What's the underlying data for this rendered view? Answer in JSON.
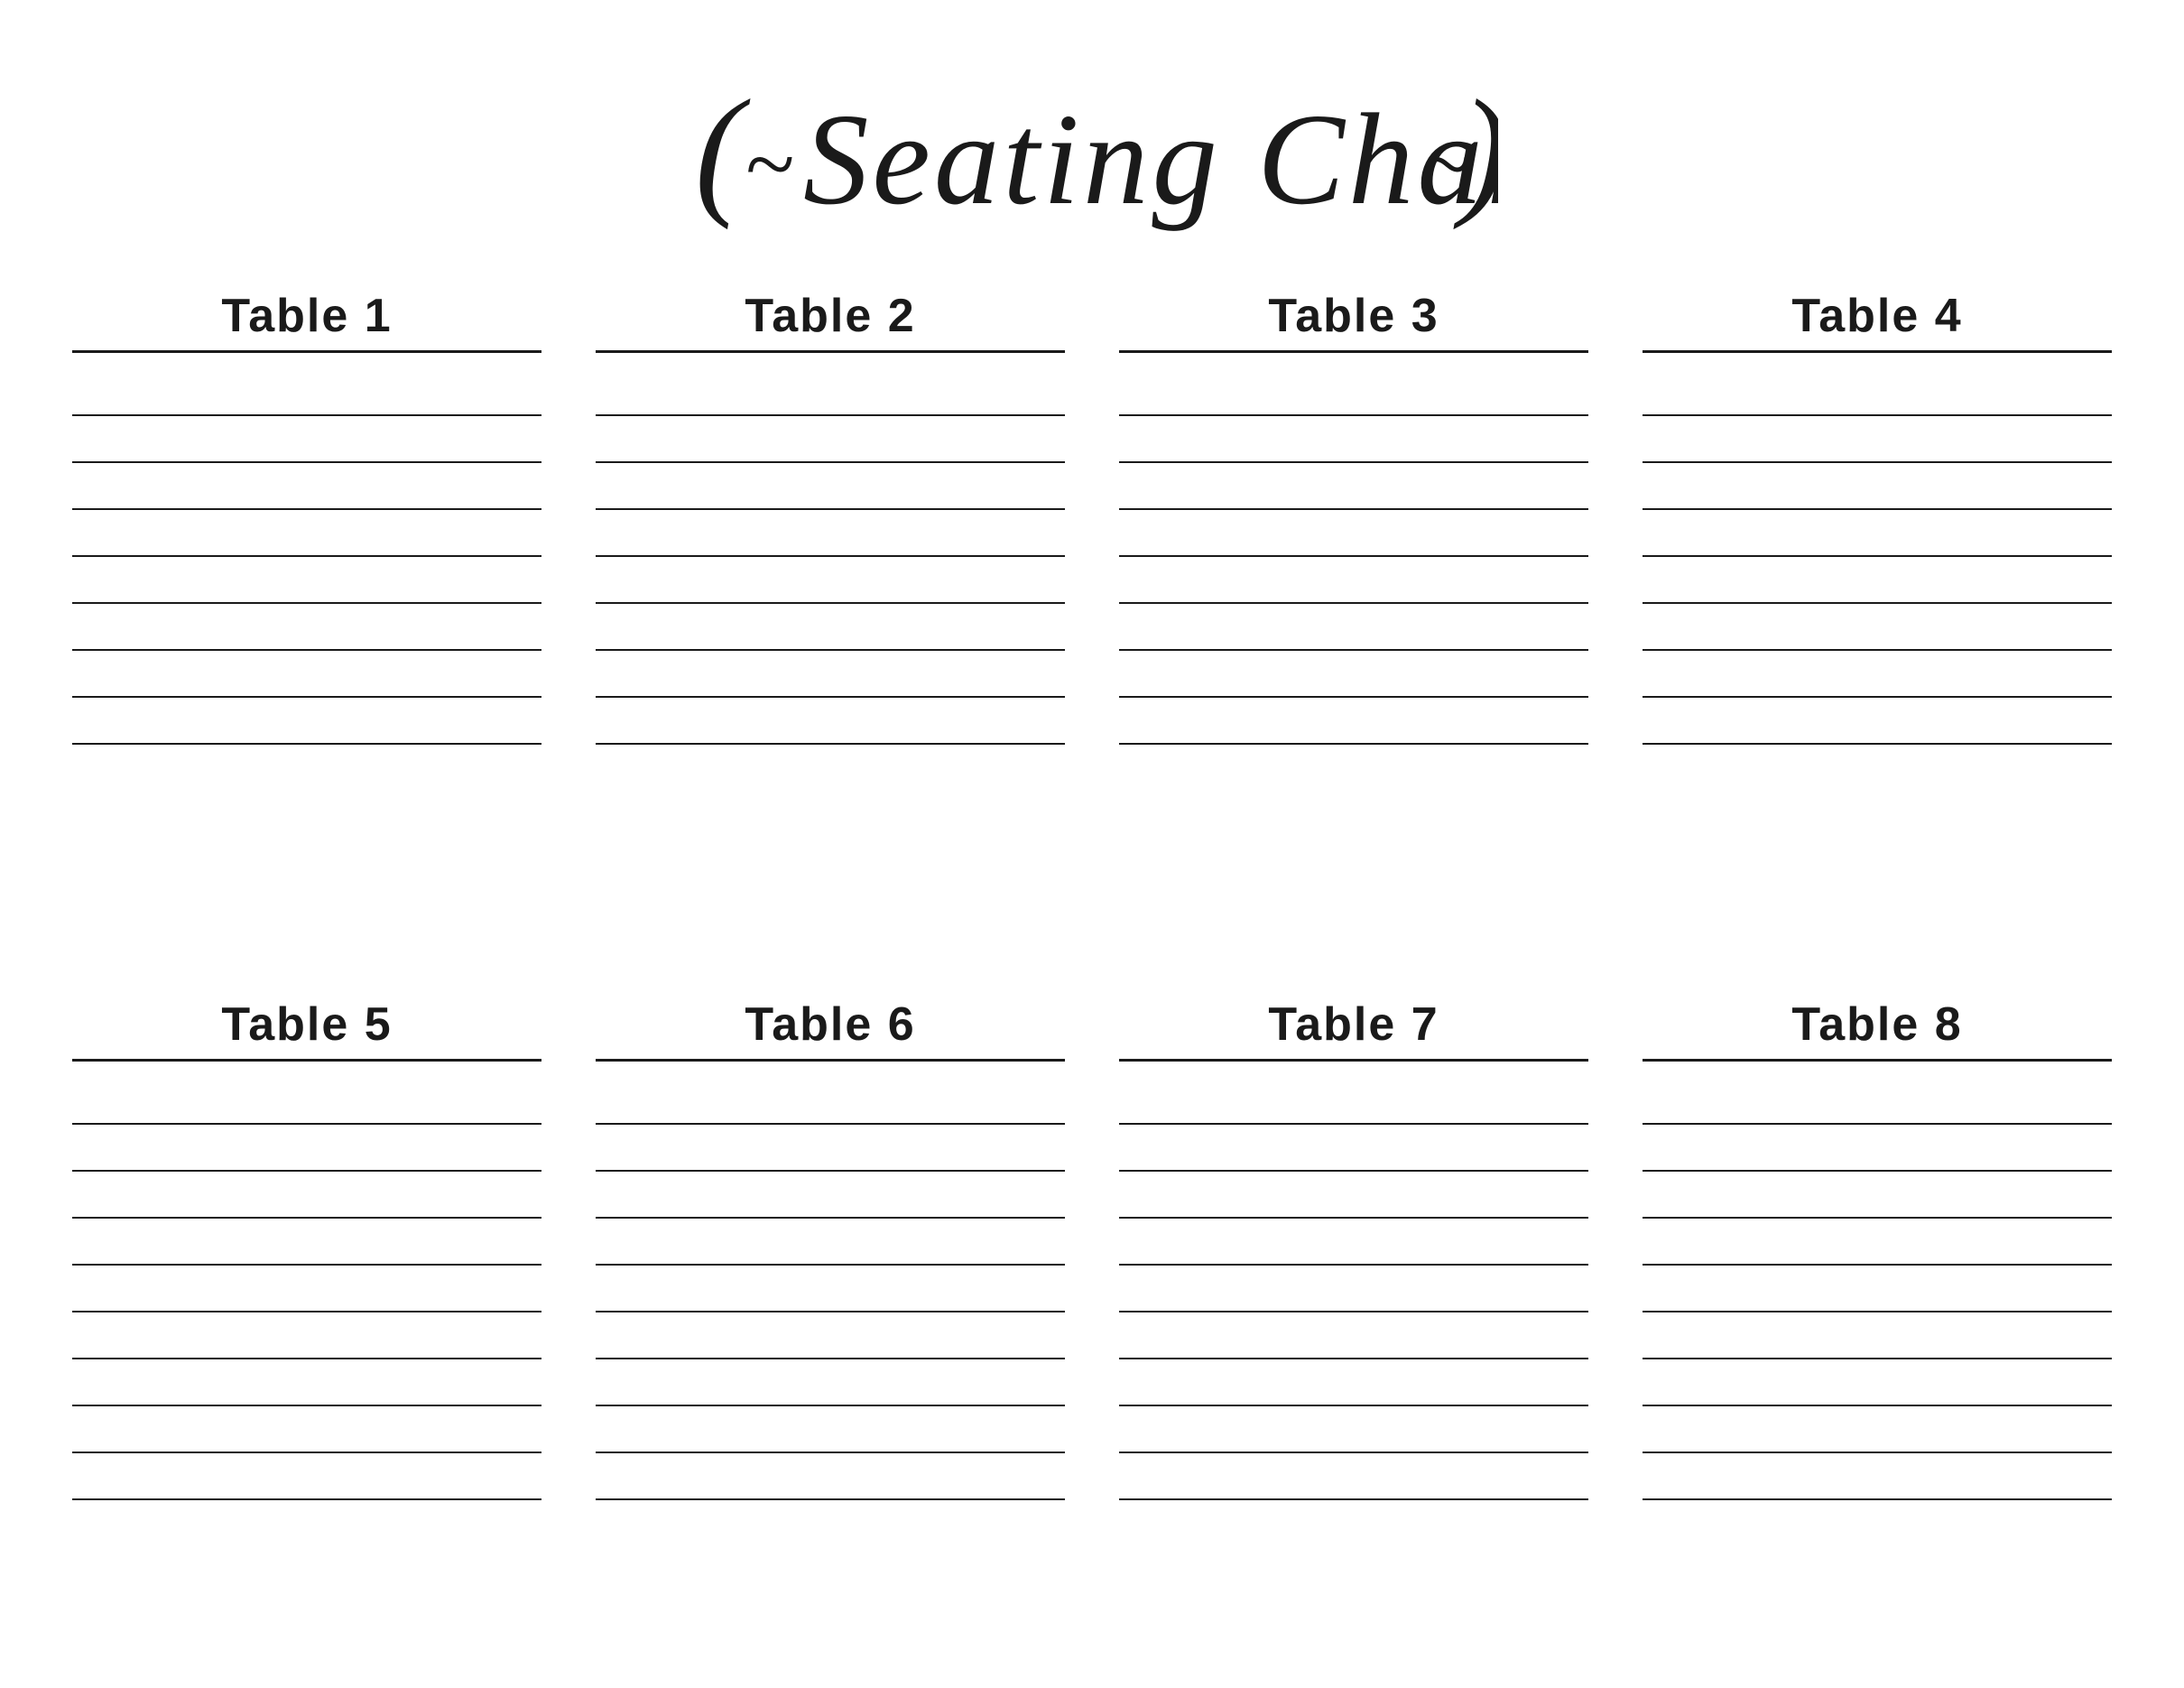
{
  "page": {
    "title": "Seating Chart",
    "title_decoration_left": "( ~",
    "title_decoration_right": "~ )",
    "background_color": "#ffffff",
    "text_color": "#1a1a1a"
  },
  "tables_row1": [
    {
      "id": "table-1",
      "label": "Table 1",
      "lines": 8
    },
    {
      "id": "table-2",
      "label": "Table 2",
      "lines": 8
    },
    {
      "id": "table-3",
      "label": "Table 3",
      "lines": 8
    },
    {
      "id": "table-4",
      "label": "Table 4",
      "lines": 8
    }
  ],
  "tables_row2": [
    {
      "id": "table-5",
      "label": "Table 5",
      "lines": 9
    },
    {
      "id": "table-6",
      "label": "Table 6",
      "lines": 9
    },
    {
      "id": "table-7",
      "label": "Table 7",
      "lines": 9
    },
    {
      "id": "table-8",
      "label": "Table 8",
      "lines": 9
    }
  ]
}
